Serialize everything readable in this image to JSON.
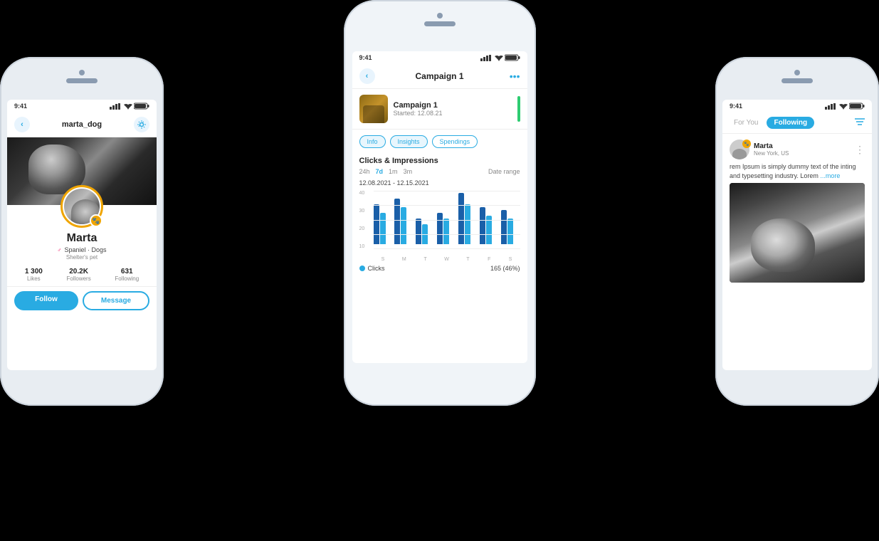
{
  "phones": {
    "left": {
      "status_time": "9:41",
      "username": "marta_dog",
      "profile_name": "Marta",
      "breed": "Spaniel · Dogs",
      "shelter": "Shelter's pet",
      "stats": [
        {
          "number": "1 300",
          "label": "Likes"
        },
        {
          "number": "20.2K",
          "label": "Followers"
        },
        {
          "number": "631",
          "label": "Following"
        }
      ],
      "btn_follow": "Follow",
      "btn_message": "Message"
    },
    "center": {
      "status_time": "9:41",
      "title": "Campaign 1",
      "campaign_name": "Campaign 1",
      "campaign_date": "Started: 12.08.21",
      "tabs": [
        "Info",
        "Insights",
        "Spendings"
      ],
      "active_tab": "Insights",
      "chart_title": "Clicks & Impressions",
      "time_filters": [
        "24h",
        "7d",
        "1m",
        "3m"
      ],
      "active_time": "7d",
      "date_range_label": "Date range",
      "date_range": "12.08.2021 - 12.15.2021",
      "y_labels": [
        "40",
        "30",
        "20",
        "10"
      ],
      "x_labels": [
        "S",
        "M",
        "T",
        "W",
        "T",
        "F",
        "S"
      ],
      "bar_data": [
        {
          "dark": 28,
          "light": 22
        },
        {
          "dark": 32,
          "light": 26
        },
        {
          "dark": 18,
          "light": 14
        },
        {
          "dark": 22,
          "light": 18
        },
        {
          "dark": 36,
          "light": 28
        },
        {
          "dark": 26,
          "light": 20
        },
        {
          "dark": 24,
          "light": 18
        }
      ],
      "legend_clicks": "Clicks",
      "legend_value": "165 (46%)"
    },
    "right": {
      "status_time": "9:41",
      "tabs": [
        "For You",
        "Following"
      ],
      "active_tab": "Following",
      "poster_name": "Marta",
      "poster_location": "New York, US",
      "post_text": "rem Ipsum is simply dummy text of the inting and typesetting industry. Lorem",
      "post_more": "...more"
    }
  }
}
